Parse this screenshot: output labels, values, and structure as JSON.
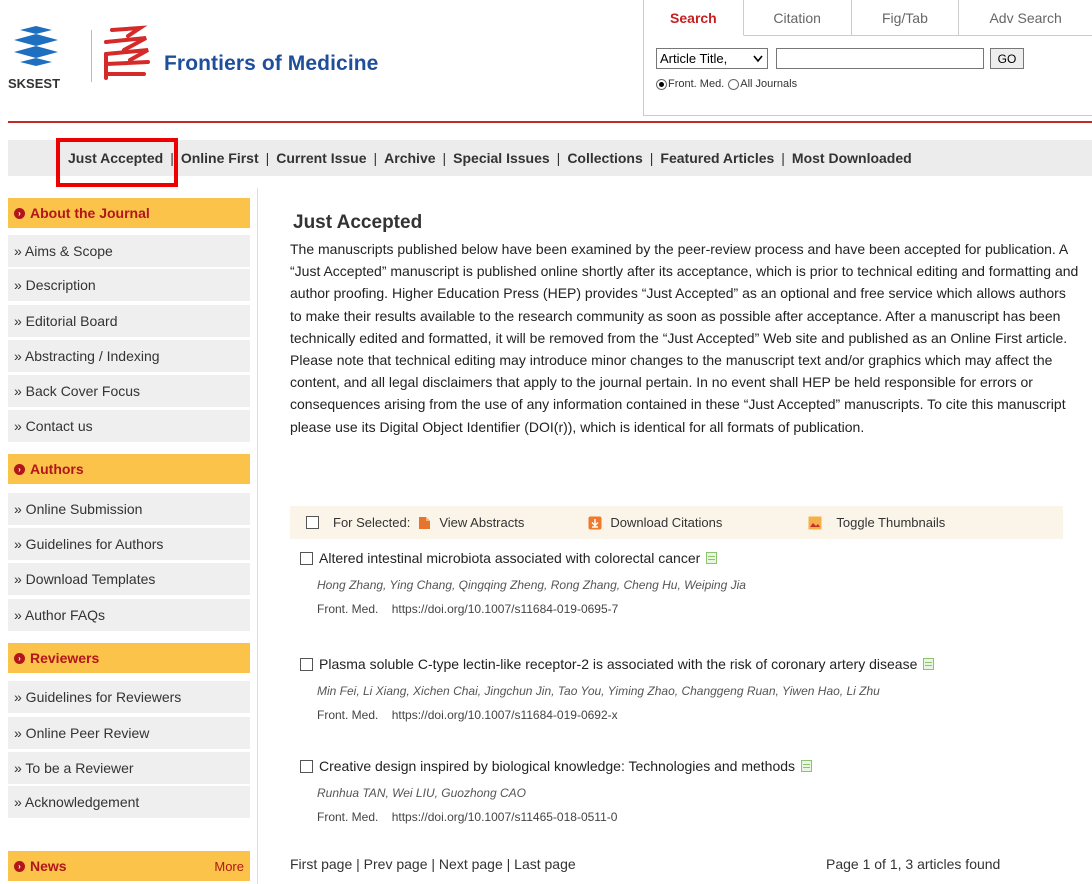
{
  "header": {
    "site_title": "Frontiers of Medicine",
    "publisher_text": "SKSEST",
    "search_tabs": [
      "Search",
      "Citation",
      "Fig/Tab",
      "Adv Search"
    ],
    "search_select": "Article Title, ",
    "search_value": "",
    "go_label": "GO",
    "radio_options": [
      "Front. Med.",
      "All Journals"
    ]
  },
  "nav": [
    "Just Accepted",
    "Online First",
    "Current Issue",
    "Archive",
    "Special Issues",
    "Collections",
    "Featured Articles",
    "Most Downloaded"
  ],
  "sidebar": {
    "about_heading": "About the Journal",
    "about_items": [
      "» Aims & Scope",
      "» Description",
      "» Editorial Board",
      "» Abstracting / Indexing",
      "» Back Cover Focus",
      "» Contact us"
    ],
    "authors_heading": "Authors",
    "authors_items": [
      "» Online Submission",
      "» Guidelines for Authors",
      "» Download Templates",
      "» Author FAQs"
    ],
    "reviewers_heading": "Reviewers",
    "reviewers_items": [
      "» Guidelines for Reviewers",
      "» Online Peer Review",
      "» To be a Reviewer",
      "» Acknowledgement"
    ],
    "news_heading": "News",
    "news_more": "More"
  },
  "main": {
    "title": "Just Accepted",
    "intro": "The manuscripts published below have been examined by the peer-review process and have been accepted for publication. A “Just Accepted” manuscript is published online shortly after its acceptance, which is prior to technical editing and formatting and author proofing. Higher Education Press (HEP) provides “Just Accepted” as an optional and free service which allows authors to make their results available to the research community as soon as possible after acceptance. After a manuscript has been technically edited and formatted, it will be removed from the “Just Accepted” Web site and published as an Online First article. Please note that technical editing may introduce minor changes to the manuscript text and/or graphics which may affect the content, and all legal disclaimers that apply to the journal pertain. In no event shall HEP be held responsible for errors or consequences arising from the use of any information contained in these “Just Accepted” manuscripts. To cite this manuscript please use its Digital Object Identifier (DOI(r)), which is identical for all formats of publication.",
    "toolbar": {
      "for_selected": "For Selected:",
      "view_abstracts": "View Abstracts",
      "download_citations": "Download Citations",
      "toggle_thumbnails": "Toggle Thumbnails"
    },
    "articles": [
      {
        "title": "Altered intestinal microbiota associated with colorectal cancer",
        "authors": "Hong Zhang, Ying Chang, Qingqing Zheng, Rong Zhang, Cheng Hu, Weiping Jia",
        "journal": "Front. Med.",
        "doi": "https://doi.org/10.1007/s11684-019-0695-7"
      },
      {
        "title": "Plasma soluble C-type lectin-like receptor-2 is associated with the risk of coronary artery disease",
        "authors": "Min Fei, Li Xiang, Xichen Chai, Jingchun Jin, Tao You, Yiming Zhao, Changgeng Ruan, Yiwen Hao, Li Zhu",
        "journal": "Front. Med.",
        "doi": "https://doi.org/10.1007/s11684-019-0692-x"
      },
      {
        "title": "Creative design inspired by biological knowledge: Technologies and methods",
        "authors": "Runhua TAN, Wei LIU, Guozhong CAO",
        "journal": "Front. Med.",
        "doi": "https://doi.org/10.1007/s11465-018-0511-0"
      }
    ],
    "pager": {
      "first": "First page",
      "prev": "Prev page",
      "next": "Next page",
      "last": "Last page",
      "summary": "Page 1 of 1, 3 articles found"
    }
  },
  "colors": {
    "brand_blue": "#1f4e9b",
    "accent_red": "#c62828",
    "sidebar_head": "#fbc34a",
    "highlight": "#ee0000"
  }
}
